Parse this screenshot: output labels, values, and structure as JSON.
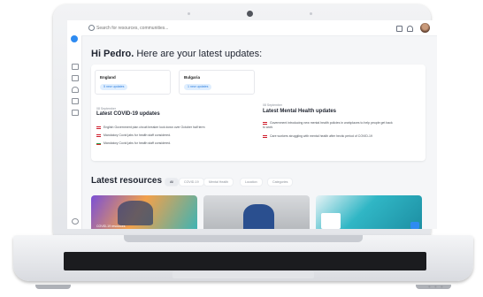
{
  "search": {
    "placeholder": "Search for resources, communities..."
  },
  "greeting": {
    "prefix": "Hi Pedro.",
    "rest": " Here are your latest updates:"
  },
  "countries": [
    {
      "name": "England",
      "badge": "5 new updates"
    },
    {
      "name": "Bulgaria",
      "badge": "1 new updates"
    }
  ],
  "covid": {
    "date": "08 September",
    "title": "Latest COVID-19 updates",
    "items": [
      "English Government plan circuit breaker lock down over October half term",
      "Mandatory Covid jabs for health staff considered.",
      "Mandatory Covid jabs for health staff considered."
    ]
  },
  "mental": {
    "date": "08 September",
    "title": "Latest Mental Health updates",
    "items": [
      "Government introducing new mental health policies in workplaces to help people get back to work",
      "Care workers struggling with mental health after hectic period of COVID-19"
    ]
  },
  "resources": {
    "title": "Latest resources",
    "filters": [
      "All",
      "COVID-19",
      "Mental Health",
      "Location",
      "Categories"
    ],
    "caption": "COVID-19 resources"
  },
  "colors": {
    "accent": "#2e8bf1",
    "background": "#f5f6f8",
    "text": "#1f2430"
  },
  "icons": [
    "search-icon",
    "message-icon",
    "bell-icon",
    "avatar",
    "home-icon",
    "folder-icon",
    "alert-icon",
    "calendar-icon",
    "settings-icon"
  ]
}
